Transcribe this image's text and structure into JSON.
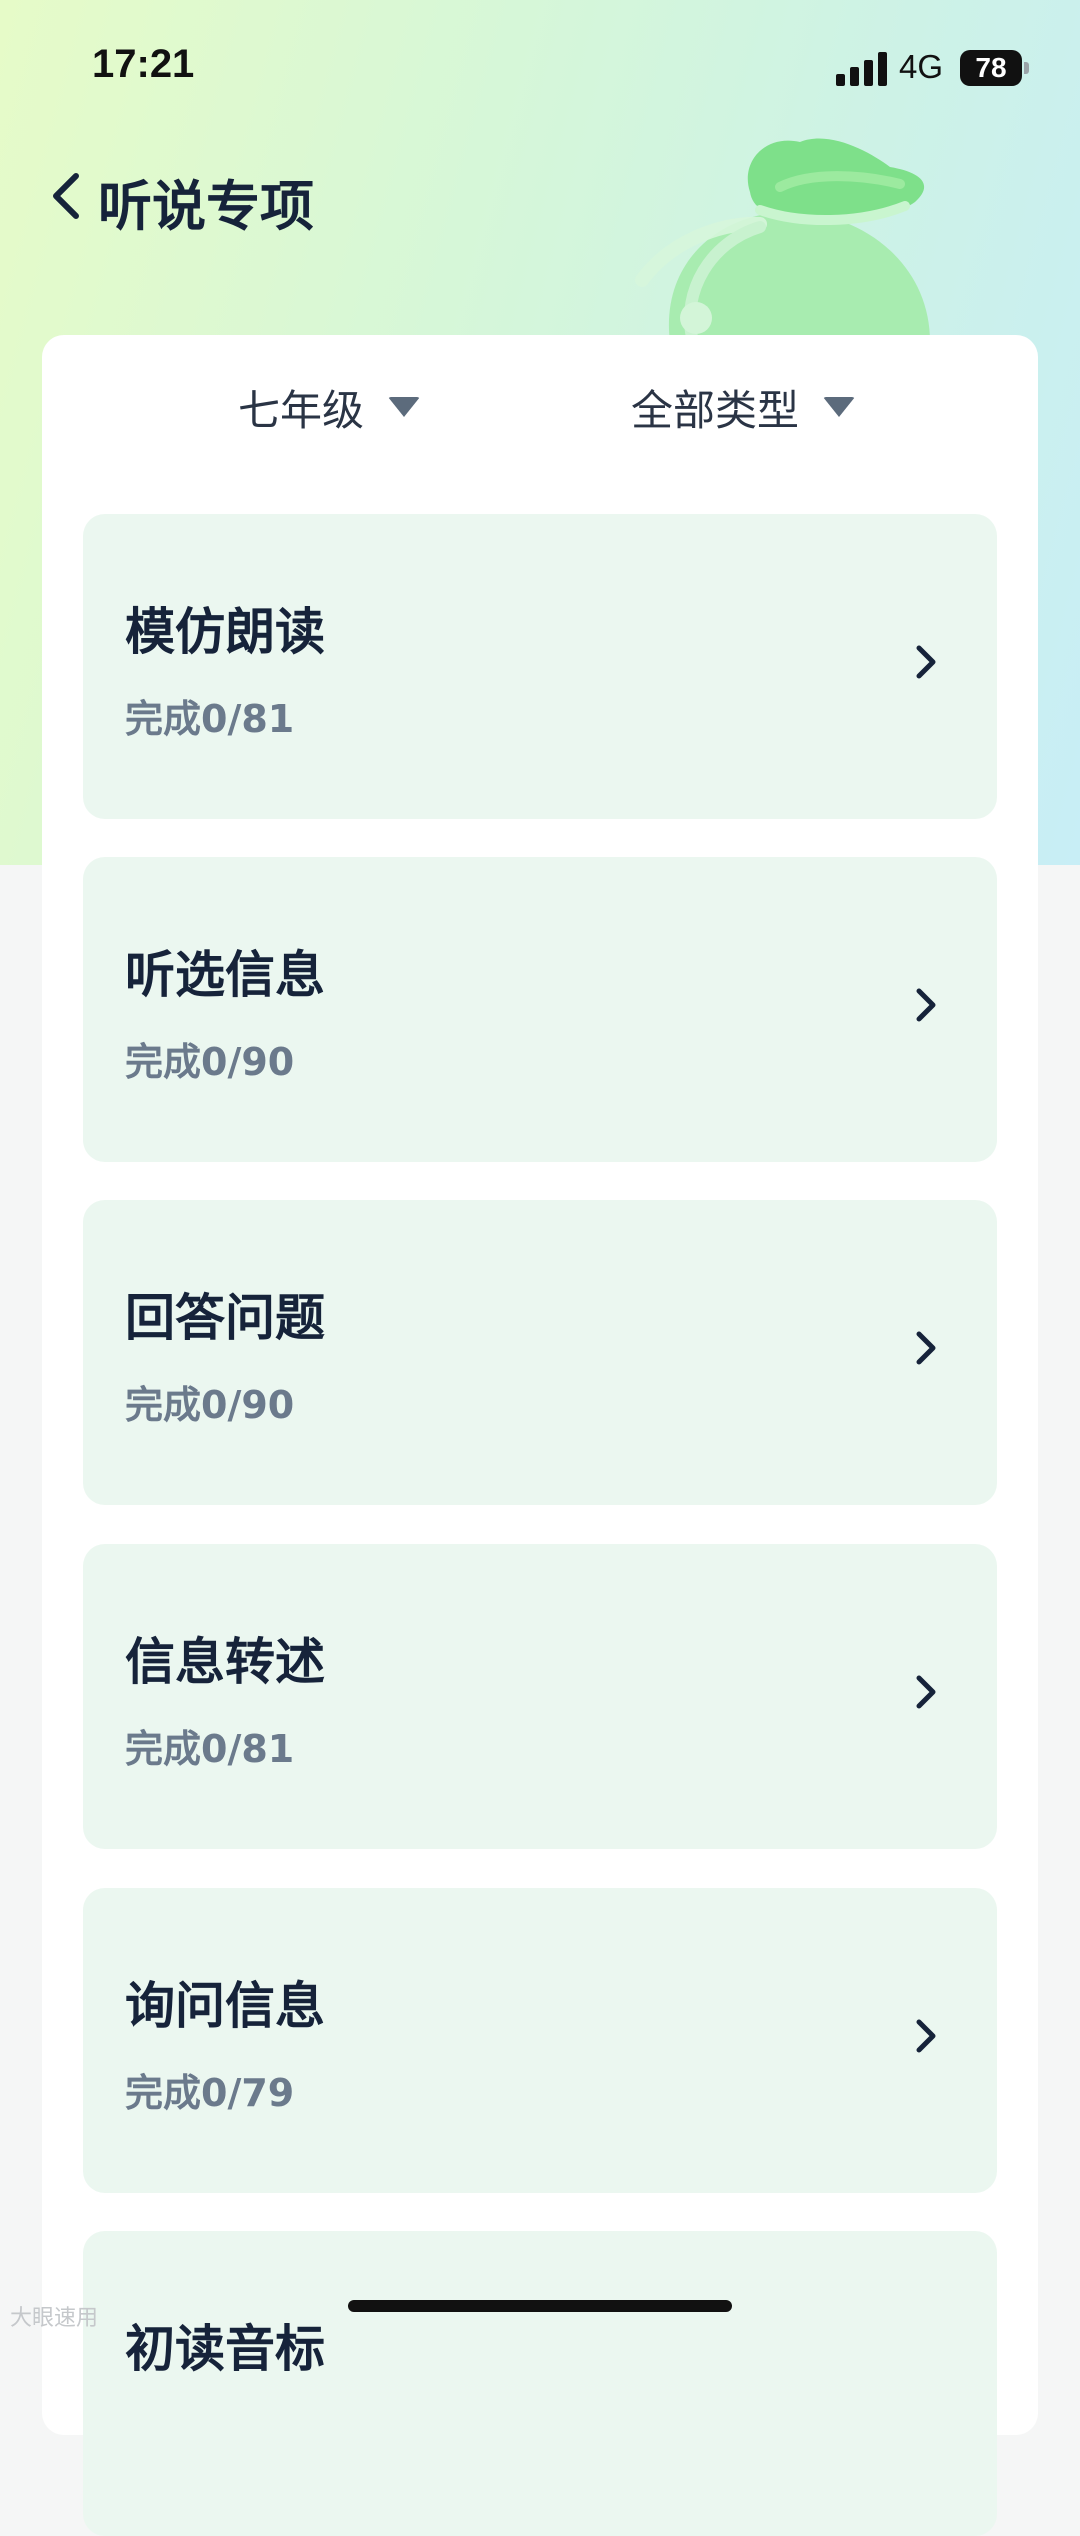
{
  "status_bar": {
    "time": "17:21",
    "network": "4G",
    "battery": "78"
  },
  "header": {
    "title": "听说专项"
  },
  "filters": {
    "grade": "七年级",
    "type": "全部类型"
  },
  "items": [
    {
      "title": "模仿朗读",
      "progress": "完成0/81"
    },
    {
      "title": "听选信息",
      "progress": "完成0/90"
    },
    {
      "title": "回答问题",
      "progress": "完成0/90"
    },
    {
      "title": "信息转述",
      "progress": "完成0/81"
    },
    {
      "title": "询问信息",
      "progress": "完成0/79"
    },
    {
      "title": "初读音标",
      "progress": ""
    }
  ],
  "watermark": "大眼速用",
  "colors": {
    "card_bg": "#ebf7f0",
    "title_text": "#16233a",
    "muted_text": "#6b7a8c",
    "accent_green": "#7ee08a"
  },
  "icons": {
    "back": "chevron-left-icon",
    "dropdown": "caret-down-icon",
    "row": "chevron-right-icon",
    "mascot": "green-bag-illustration"
  }
}
